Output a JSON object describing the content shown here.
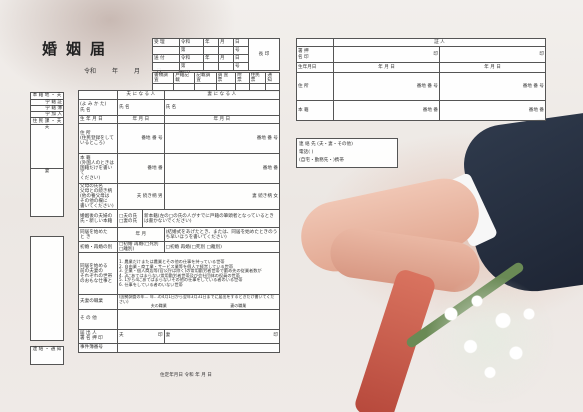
{
  "form": {
    "title": "婚姻届",
    "date_labels": [
      "令和",
      "年",
      "月",
      "日"
    ],
    "delivery_to": "届出",
    "attestation": "長 殿"
  },
  "receipt": {
    "rows": [
      [
        "受 理",
        "令和",
        "年",
        "月",
        "日"
      ],
      [
        "",
        "第",
        "",
        "",
        "号"
      ],
      [
        "送 付",
        "令和",
        "年",
        "月",
        "日"
      ],
      [
        "",
        "第",
        "",
        "",
        "号"
      ]
    ],
    "sub_headers": [
      "書類調査",
      "戸籍記載",
      "記載調査",
      "調 査 票",
      "附 票",
      "住民票",
      "通 知"
    ],
    "chief": "長 印"
  },
  "sidebar_left": {
    "items": [
      "本 籍 地 ・ 夫",
      "学 籍 証",
      "学 籍 簿",
      "学 加 入",
      "住 民 課 ・ 夫",
      "夫",
      "妻"
    ],
    "bottom": [
      "連 絡 ・ 通 知"
    ]
  },
  "main": {
    "header_husband": "夫 に な る 人",
    "header_wife": "妻 に な る 人",
    "rows": [
      {
        "no": "(1)",
        "label": "(よ み か た)\n氏 名",
        "h": "氏 名",
        "w": "氏 名"
      },
      {
        "no": "",
        "label": "生 年 月 日",
        "h": "年 月 日",
        "w": "年 月 日"
      },
      {
        "no": "",
        "label": "住 所\n(住民登録をして\nいるところ)",
        "h": "番地 番 号",
        "w": "番地 番 号"
      },
      {
        "no": "(2)",
        "label": "本 籍\n(外国人のときは\n国籍だけを書いて\nください)",
        "h": "番地 番",
        "w": "番地 番"
      },
      {
        "no": "",
        "label": "父母の氏名\n父母との続き柄\n(他の養父母は\nその他の欄に\n書いてください)",
        "h": "夫 続き柄 男",
        "w": "妻 続き柄 女"
      }
    ],
    "marriage_name_label": "婚姻後の夫婦の\n氏・新しい本籍",
    "marriage_name_options": [
      "□夫の氏",
      "□妻の氏"
    ],
    "marriage_name_note": "新本籍(左の□の氏の人がすでに戸籍の筆頭者となっているときは書かないでください)",
    "cohabit_label": "同居を始めた\nと き",
    "cohabit_value": "年 月",
    "cohabit_note": "(結婚式をあげたとき、または、同居を始めたときのうち早いほうを書いてください)",
    "prev_label": "初婚・再婚の別",
    "prev_options": [
      "□初婚",
      "再婚(□死別 □離別)",
      "年 月 日"
    ],
    "job_label": "同居を始める\n前の夫妻の\nそれぞれの世帯\nのおもな仕事と",
    "job_items": [
      "1. 農業だけまたは農業とその他の仕事を持っている世帯",
      "2. 自由業・商工業・サービス業等を個人で経営している世帯",
      "3. 企業・個人商店等(官公庁は除く)の常用勤労者世帯で勤め先の従業者数が",
      "4. 3にあてはまらない常用勤労者世帯及び会社団体の役員の世帯",
      "5. 1から4にあてはまらないその他の仕事をしている者のいる世帯",
      "6. 仕事をしている者のいない世帯"
    ],
    "occupation_label": "夫妻の職業",
    "occupation_note": "(国勢調査の年… 年…の4月1日から翌年3月31日までに届出をするときだけ書いてください)",
    "occupation_h": "夫の職業",
    "occupation_w": "妻の職業",
    "other_label": "そ の 他",
    "sign_label": "届 出 人\n署 名 押 印",
    "sign_h": "夫",
    "sign_w": "妻",
    "seal": "印",
    "case_label": "事件簿番号",
    "footer": [
      "住定年月日",
      "令和",
      "年",
      "月",
      "日"
    ]
  },
  "witness": {
    "header": "証 人",
    "rows": [
      {
        "label": "署 押\n名 印",
        "v1": "印",
        "v2": "印"
      },
      {
        "label": "生年月日",
        "v1": "年 月 日",
        "v2": "年 月 日"
      },
      {
        "label": "住 所",
        "v1": "番地 番 号",
        "v2": "番地 番 号"
      },
      {
        "label": "本 籍",
        "v1": "番地 番",
        "v2": "番地 番"
      }
    ]
  },
  "contact": {
    "title": "連 絡 先 (夫・妻・その他)",
    "phone": "電話(   )",
    "phone_label": "電話",
    "type_label": "(自宅・勤務先・",
    "type_suffix": ")携帯"
  }
}
